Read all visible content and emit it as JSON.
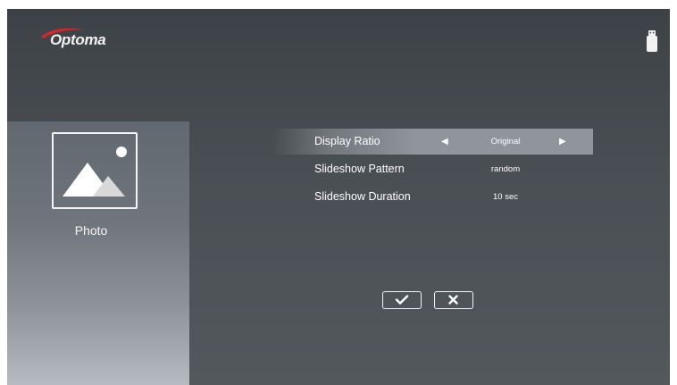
{
  "brand": {
    "name": "Optoma",
    "swoosh_color": "#d9262c"
  },
  "status": {
    "storage_icon": "usb-drive-icon"
  },
  "sidebar": {
    "icon": "photo-icon",
    "label": "Photo"
  },
  "settings": [
    {
      "label": "Display Ratio",
      "value": "Original",
      "selected": true,
      "left_arrow": "◀",
      "right_arrow": "▶"
    },
    {
      "label": "Slideshow Pattern",
      "value": "random",
      "selected": false
    },
    {
      "label": "Slideshow Duration",
      "value": "10 sec",
      "selected": false
    }
  ],
  "actions": {
    "confirm_icon": "checkmark-icon",
    "cancel_icon": "close-icon"
  },
  "colors": {
    "highlight": "#8f959b",
    "panel_background": "#4a4f54",
    "text": "#ffffff"
  }
}
